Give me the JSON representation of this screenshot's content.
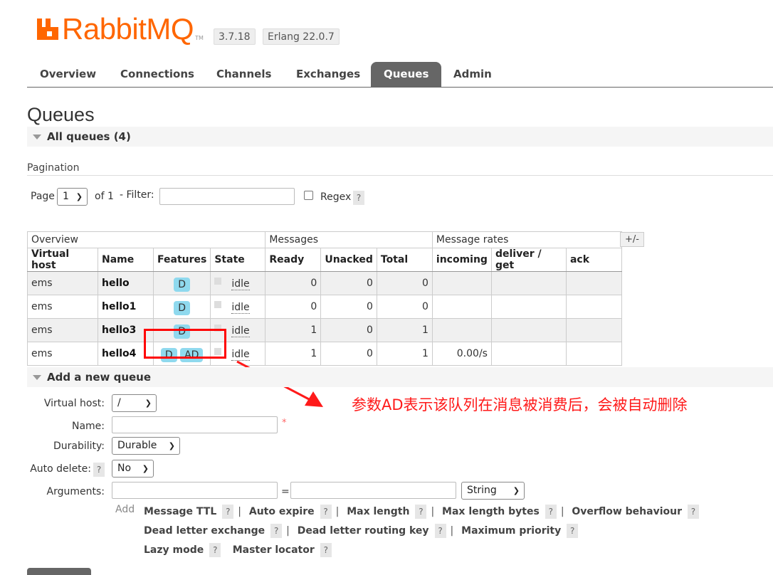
{
  "header": {
    "logo_text": "RabbitMQ",
    "logo_tm": "TM",
    "version": "3.7.18",
    "erlang": "Erlang 22.0.7"
  },
  "tabs": [
    {
      "label": "Overview"
    },
    {
      "label": "Connections"
    },
    {
      "label": "Channels"
    },
    {
      "label": "Exchanges"
    },
    {
      "label": "Queues",
      "active": true
    },
    {
      "label": "Admin"
    }
  ],
  "page": {
    "title": "Queues",
    "all_queues": "All queues (4)",
    "pagination_label": "Pagination",
    "page_label": "Page",
    "page_value": "1",
    "of_label": "of 1",
    "filter_label": "- Filter:",
    "filter_value": "",
    "regex_label": "Regex",
    "help_glyph": "?"
  },
  "table": {
    "groups": [
      "Overview",
      "Messages",
      "Message rates"
    ],
    "columns": [
      "Virtual host",
      "Name",
      "Features",
      "State",
      "Ready",
      "Unacked",
      "Total",
      "incoming",
      "deliver / get",
      "ack"
    ],
    "plus_minus": "+/-",
    "rows": [
      {
        "vhost": "ems",
        "name": "hello",
        "features": [
          "D"
        ],
        "state": "idle",
        "ready": "0",
        "unacked": "0",
        "total": "0",
        "incoming": "",
        "deliver": "",
        "ack": ""
      },
      {
        "vhost": "ems",
        "name": "hello1",
        "features": [
          "D"
        ],
        "state": "idle",
        "ready": "0",
        "unacked": "0",
        "total": "0",
        "incoming": "",
        "deliver": "",
        "ack": ""
      },
      {
        "vhost": "ems",
        "name": "hello3",
        "features": [
          "D"
        ],
        "state": "idle",
        "ready": "1",
        "unacked": "0",
        "total": "1",
        "incoming": "",
        "deliver": "",
        "ack": ""
      },
      {
        "vhost": "ems",
        "name": "hello4",
        "features": [
          "D",
          "AD"
        ],
        "state": "idle",
        "ready": "1",
        "unacked": "0",
        "total": "1",
        "incoming": "0.00/s",
        "deliver": "",
        "ack": ""
      }
    ]
  },
  "annotation": {
    "text": "参数AD表示该队列在消息被消费后，会被自动删除",
    "color": "#ff1a1a"
  },
  "add_queue": {
    "title": "Add a new queue",
    "vhost_label": "Virtual host:",
    "vhost_value": "/",
    "name_label": "Name:",
    "name_value": "",
    "required_mark": "*",
    "durability_label": "Durability:",
    "durability_value": "Durable",
    "autodelete_label": "Auto delete:",
    "autodelete_value": "No",
    "arguments_label": "Arguments:",
    "arg_key": "",
    "arg_value": "",
    "equals": "=",
    "arg_type": "String",
    "add_label": "Add",
    "arg_links": [
      [
        "Message TTL",
        "Auto expire",
        "Max length",
        "Max length bytes",
        "Overflow behaviour"
      ],
      [
        "Dead letter exchange",
        "Dead letter routing key",
        "Maximum priority"
      ],
      [
        "Lazy mode",
        "Master locator"
      ]
    ]
  },
  "colors": {
    "brand": "#ff6600",
    "tab_active": "#666666",
    "feature_badge": "#8fd9ee",
    "highlight_box": "#ff0000"
  }
}
